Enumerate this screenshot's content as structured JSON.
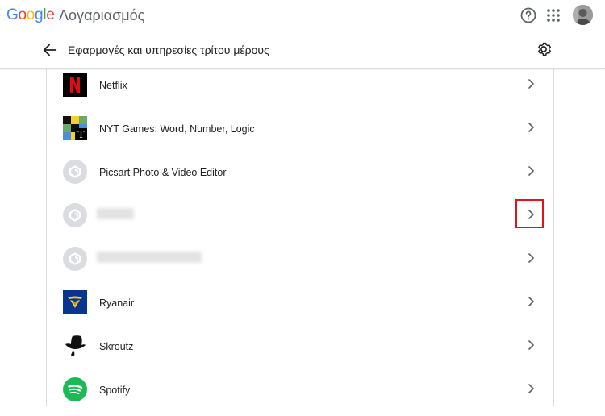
{
  "header": {
    "logo_letters": [
      "G",
      "o",
      "o",
      "g",
      "l",
      "e"
    ],
    "product_name": "Λογαριασμός",
    "help_icon": "help-circle-icon",
    "apps_icon": "apps-grid-icon",
    "avatar_icon": "user-avatar"
  },
  "page": {
    "back_icon": "arrow-back-icon",
    "title": "Εφαρμογές και υπηρεσίες τρίτου μέρους",
    "settings_icon": "gear-icon"
  },
  "apps": [
    {
      "name": "Netflix",
      "icon": "netflix-logo"
    },
    {
      "name": "NYT Games: Word, Number, Logic",
      "icon": "nyt-games-logo"
    },
    {
      "name": "Picsart Photo & Video Editor",
      "icon": "generic-app-logo"
    },
    {
      "name": "",
      "icon": "generic-app-logo",
      "blurred": true
    },
    {
      "name": "",
      "icon": "generic-app-logo",
      "blurred": true
    },
    {
      "name": "Ryanair",
      "icon": "ryanair-logo"
    },
    {
      "name": "Skroutz",
      "icon": "skroutz-logo"
    },
    {
      "name": "Spotify",
      "icon": "spotify-logo"
    }
  ],
  "colors": {
    "accent_highlight": "#e0151b",
    "netflix_red": "#e50914",
    "ryanair_blue": "#073590",
    "spotify_green": "#1db954"
  }
}
